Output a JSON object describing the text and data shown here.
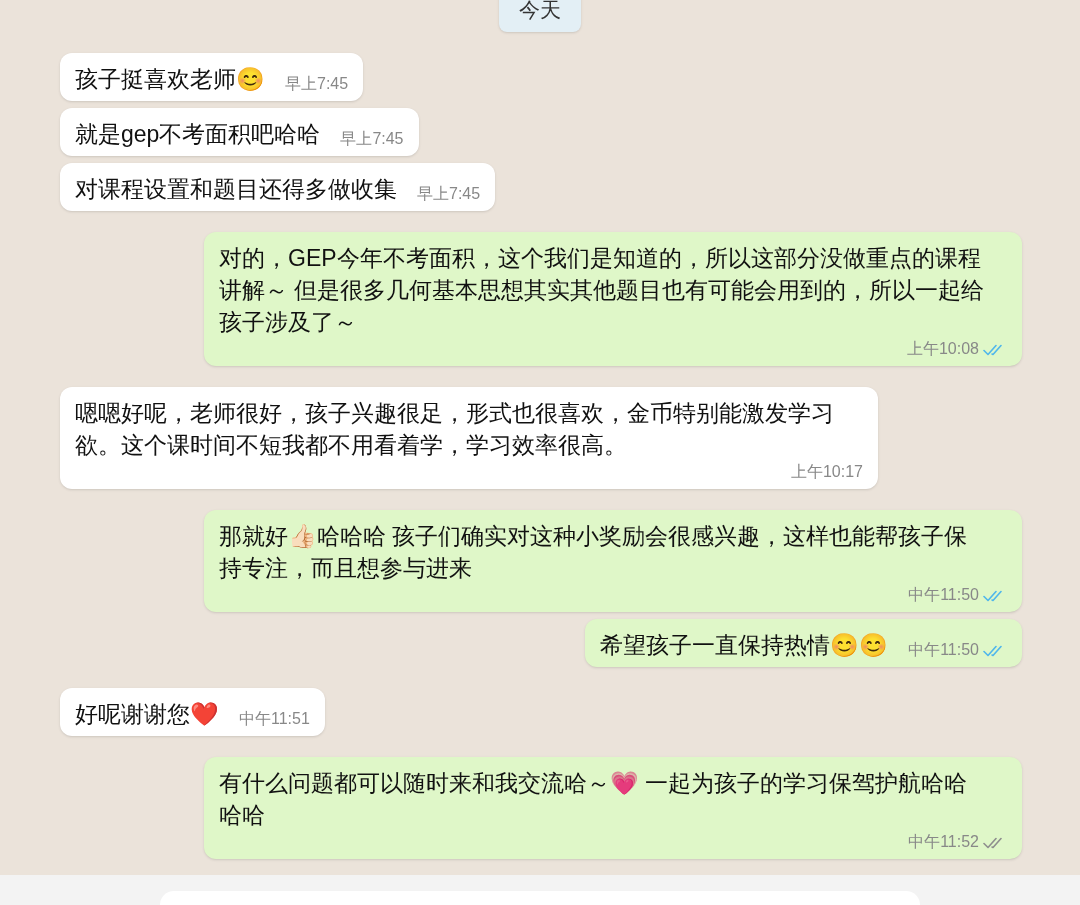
{
  "date_chip": "今天",
  "messages": [
    {
      "outgoing": false,
      "text": "孩子挺喜欢老师😊",
      "time": "早上7:45"
    },
    {
      "outgoing": false,
      "text": "就是gep不考面积吧哈哈",
      "time": "早上7:45"
    },
    {
      "outgoing": false,
      "text": "对课程设置和题目还得多做收集",
      "time": "早上7:45"
    },
    {
      "outgoing": true,
      "text": "对的，GEP今年不考面积，这个我们是知道的，所以这部分没做重点的课程讲解～ 但是很多几何基本思想其实其他题目也有可能会用到的，所以一起给孩子涉及了～",
      "time": "上午10:08",
      "read": true
    },
    {
      "outgoing": false,
      "text": "嗯嗯好呢，老师很好，孩子兴趣很足，形式也很喜欢，金币特别能激发学习欲。这个课时间不短我都不用看着学，学习效率很高。",
      "time": "上午10:17"
    },
    {
      "outgoing": true,
      "text": "那就好👍🏻哈哈哈 孩子们确实对这种小奖励会很感兴趣，这样也能帮孩子保持专注，而且想参与进来",
      "time": "中午11:50",
      "read": true
    },
    {
      "outgoing": true,
      "text": "希望孩子一直保持热情😊😊",
      "time": "中午11:50",
      "read": true
    },
    {
      "outgoing": false,
      "text": "好呢谢谢您❤️",
      "time": "中午11:51"
    },
    {
      "outgoing": true,
      "text": "有什么问题都可以随时来和我交流哈～💗 一起为孩子的学习保驾护航哈哈哈哈",
      "time": "中午11:52",
      "read": false
    }
  ]
}
